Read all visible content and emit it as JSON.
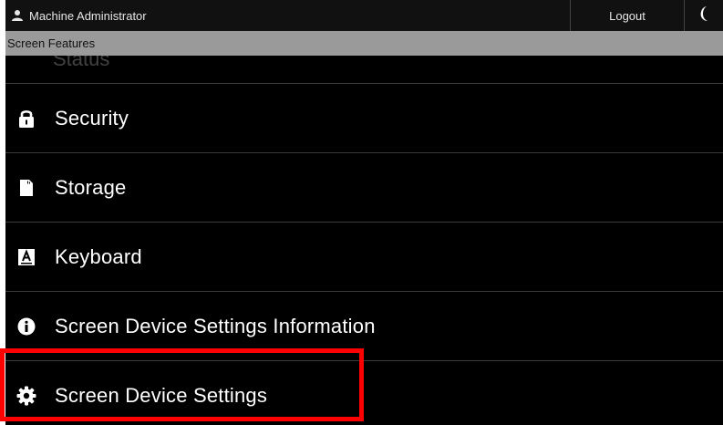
{
  "topbar": {
    "user_label": "Machine Administrator",
    "logout_label": "Logout",
    "theme_icon": "moon-icon"
  },
  "subbar": {
    "title": "Screen Features"
  },
  "list": {
    "ghost_item": "Status",
    "items": [
      {
        "label": "Security",
        "icon": "lock-icon"
      },
      {
        "label": "Storage",
        "icon": "sd-card-icon"
      },
      {
        "label": "Keyboard",
        "icon": "keyboard-icon"
      },
      {
        "label": "Screen Device Settings Information",
        "icon": "info-icon"
      },
      {
        "label": "Screen Device Settings",
        "icon": "gear-icon"
      }
    ]
  },
  "colors": {
    "background": "#000000",
    "topbar": "#111111",
    "subbar": "#9a9a9a",
    "divider": "#3a3a3a",
    "highlight": "#ff0000"
  }
}
